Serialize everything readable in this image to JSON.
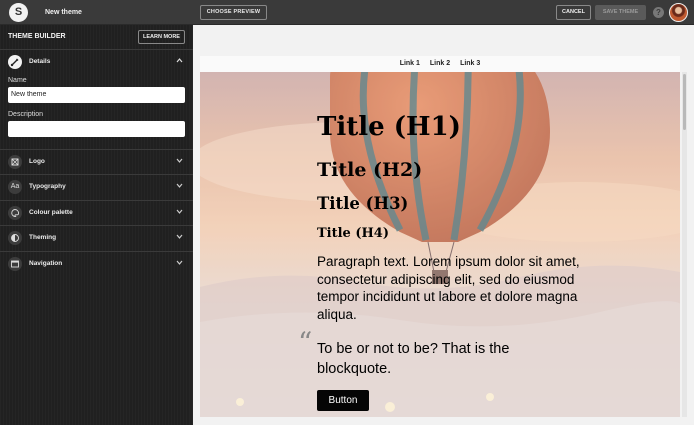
{
  "topbar": {
    "logo_letter": "S",
    "title": "New theme",
    "choose_preview": "CHOOSE PREVIEW",
    "cancel": "CANCEL",
    "save_theme": "SAVE THEME",
    "help": "?"
  },
  "sidebar": {
    "title": "THEME BUILDER",
    "learn_more": "LEARN MORE",
    "details": {
      "label": "Details",
      "name_label": "Name",
      "name_value": "New theme",
      "description_label": "Description",
      "description_value": ""
    },
    "sections": [
      {
        "label": "Logo",
        "icon": "image-icon"
      },
      {
        "label": "Typography",
        "icon": "typography-icon"
      },
      {
        "label": "Colour palette",
        "icon": "palette-icon"
      },
      {
        "label": "Theming",
        "icon": "contrast-icon"
      },
      {
        "label": "Navigation",
        "icon": "window-icon"
      }
    ]
  },
  "preview": {
    "links": [
      "Link 1",
      "Link 2",
      "Link 3"
    ],
    "h1": "Title (H1)",
    "h2": "Title (H2)",
    "h3": "Title (H3)",
    "h4": "Title (H4)",
    "paragraph": "Paragraph text. Lorem ipsum dolor sit amet, consectetur adipiscing elit, sed do eiusmod tempor incididunt ut labore et dolore magna aliqua.",
    "quote_mark": "“",
    "blockquote": "To be or not to be? That is the blockquote.",
    "button": "Button"
  }
}
